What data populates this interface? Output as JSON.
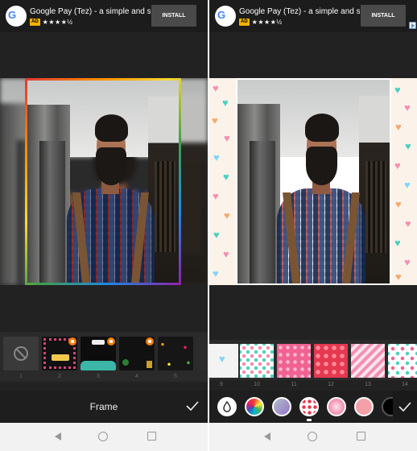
{
  "ad": {
    "title": "Google Pay (Tez) - a simple and s...",
    "badge": "AD",
    "stars": "★★★★½",
    "install_label": "INSTALL",
    "icon_text_g": "G",
    "icon_text_pay": "Pay"
  },
  "left": {
    "tray_items": [
      {
        "num": "1",
        "type": "none"
      },
      {
        "num": "2",
        "type": "frame",
        "locked": true
      },
      {
        "num": "3",
        "type": "frame",
        "locked": true
      },
      {
        "num": "4",
        "type": "frame",
        "locked": true
      },
      {
        "num": "5",
        "type": "frame",
        "locked": false
      }
    ],
    "bottom_label": "Frame"
  },
  "right": {
    "patterns": [
      {
        "num": "9"
      },
      {
        "num": "10"
      },
      {
        "num": "11"
      },
      {
        "num": "12"
      },
      {
        "num": "13"
      },
      {
        "num": "14"
      }
    ],
    "tools": [
      "drop-icon",
      "color-wheel-icon",
      "gradient-icon",
      "pattern-icon",
      "texture-icon",
      "pink-circle-icon",
      "more-icon"
    ]
  },
  "colors": {
    "ad_badge": "#f3b300",
    "lock": "#f57c00",
    "pink": "#e84a6a",
    "panel_bg": "#222222"
  },
  "navbar": {
    "back": "back-icon",
    "home": "home-icon",
    "recent": "recent-apps-icon"
  }
}
